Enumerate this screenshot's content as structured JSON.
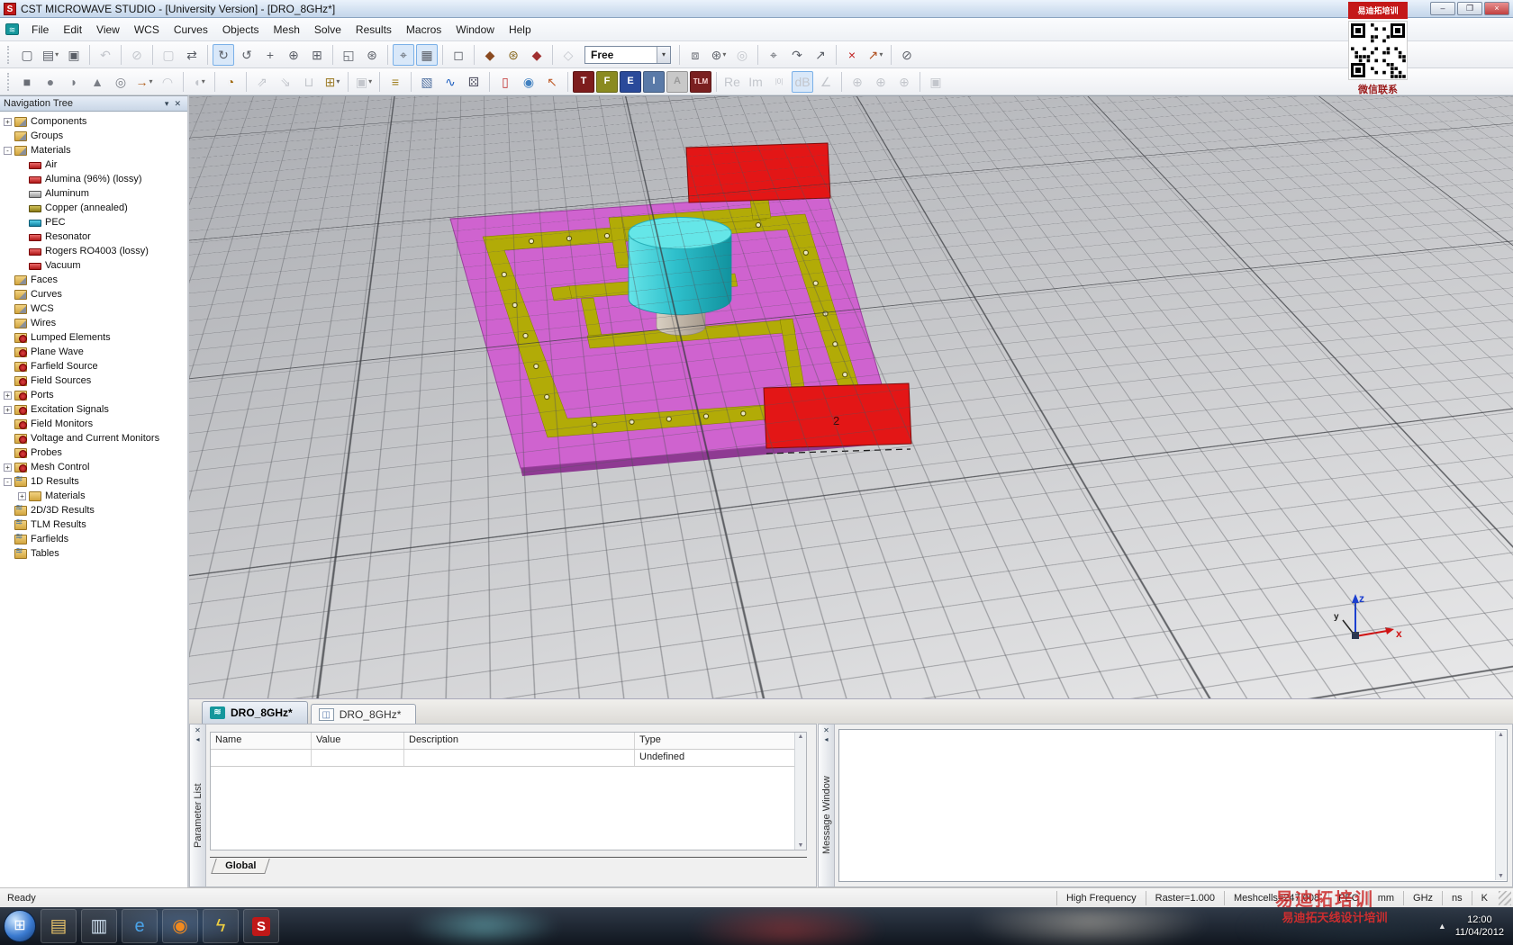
{
  "window": {
    "title": "CST MICROWAVE STUDIO - [University Version] - [DRO_8GHz*]",
    "min_label": "–",
    "restore_label": "❐",
    "close_label": "×"
  },
  "menu": {
    "items": [
      "File",
      "Edit",
      "View",
      "WCS",
      "Curves",
      "Objects",
      "Mesh",
      "Solve",
      "Results",
      "Macros",
      "Window",
      "Help"
    ]
  },
  "toolbars": {
    "row1": [
      {
        "n": "new-file",
        "g": "▢"
      },
      {
        "n": "open-file",
        "g": "▤",
        "d": 1
      },
      {
        "n": "save",
        "g": "▣"
      },
      {
        "sep": true
      },
      {
        "n": "undo",
        "g": "↶",
        "s": "g"
      },
      {
        "sep": true
      },
      {
        "n": "abort",
        "g": "⊘",
        "s": "g"
      },
      {
        "sep": true
      },
      {
        "n": "select-tool",
        "g": "▢",
        "s": "g"
      },
      {
        "n": "exchange-tool",
        "g": "⇄"
      },
      {
        "sep": true
      },
      {
        "n": "rotate-view",
        "g": "↻",
        "s": "a"
      },
      {
        "n": "rotate-in-plane",
        "g": "↺"
      },
      {
        "n": "pan-view",
        "g": "+"
      },
      {
        "n": "zoom-dynamic",
        "g": "⊕"
      },
      {
        "n": "zoom-rectangle",
        "g": "⊞"
      },
      {
        "sep": true
      },
      {
        "n": "reset-view",
        "g": "◱"
      },
      {
        "n": "view-options",
        "g": "⊛"
      },
      {
        "sep": true
      },
      {
        "n": "show-axes",
        "g": "⌖",
        "s": "a"
      },
      {
        "n": "show-working-plane-raster",
        "g": "▦",
        "s": "a"
      },
      {
        "sep": true
      },
      {
        "n": "wireframe-view",
        "g": "◻"
      },
      {
        "sep": true
      },
      {
        "n": "material-tool-brown",
        "g": "◆",
        "fg": "#8a4a20"
      },
      {
        "n": "material-parameters",
        "g": "⊛",
        "fg": "#8a6a20"
      },
      {
        "n": "material-tool-red",
        "g": "◆",
        "fg": "#a03030"
      },
      {
        "sep": true
      },
      {
        "n": "shape-blend",
        "g": "◇",
        "s": "g"
      },
      {
        "combo": true,
        "n": "pick-mode-combo",
        "v": "Free"
      },
      {
        "sep": true
      },
      {
        "n": "working-plane-properties",
        "g": "⧈"
      },
      {
        "n": "global-mesh-properties",
        "g": "⊛",
        "d": 1
      },
      {
        "n": "specials",
        "g": "◎",
        "s": "g"
      },
      {
        "sep": true
      },
      {
        "n": "local-wcs",
        "g": "⌖"
      },
      {
        "n": "align-wcs",
        "g": "↷"
      },
      {
        "n": "transform-wcs",
        "g": "↗"
      },
      {
        "sep": true
      },
      {
        "n": "slice-tool",
        "g": "×",
        "fg": "#c02020"
      },
      {
        "n": "pick-points",
        "g": "↗",
        "fg": "#b05020",
        "d": 1
      },
      {
        "sep": true
      },
      {
        "n": "clear-picks",
        "g": "⊘"
      }
    ],
    "row2": [
      {
        "n": "create-brick",
        "g": "■",
        "fg": "#6a6e76"
      },
      {
        "n": "create-sphere",
        "g": "●",
        "fg": "#7a7e86"
      },
      {
        "n": "create-cylinder",
        "g": "◗",
        "fg": "#7a7e86"
      },
      {
        "n": "create-cone",
        "g": "▲",
        "fg": "#7a7e86"
      },
      {
        "n": "create-torus",
        "g": "◎",
        "fg": "#7a7e86"
      },
      {
        "n": "extrude",
        "g": "→",
        "fg": "#b06020",
        "d": 1
      },
      {
        "n": "loft",
        "g": "◠",
        "s": "g"
      },
      {
        "sep": true
      },
      {
        "n": "blend",
        "g": "◖",
        "s": "g",
        "d": 1
      },
      {
        "sep": true
      },
      {
        "n": "history-list",
        "g": "◔",
        "fg": "#a06a10"
      },
      {
        "sep": true
      },
      {
        "n": "transform-shape",
        "g": "⇗",
        "s": "g"
      },
      {
        "n": "align-shape",
        "g": "⇘",
        "s": "g"
      },
      {
        "n": "boolean-tool",
        "g": "⊔",
        "s": "g"
      },
      {
        "n": "new-component",
        "g": "⊞",
        "fg": "#a08030",
        "d": 1
      },
      {
        "sep": true
      },
      {
        "n": "group-tool",
        "g": "▣",
        "s": "g",
        "d": 1
      },
      {
        "sep": true
      },
      {
        "n": "units",
        "g": "≡",
        "fg": "#a08020"
      },
      {
        "sep": true
      },
      {
        "n": "background-properties",
        "g": "▧",
        "fg": "#5070a0"
      },
      {
        "n": "frequency-range",
        "g": "∿",
        "fg": "#2060c0"
      },
      {
        "n": "boundary-conditions",
        "g": "⚄",
        "fg": "#556"
      },
      {
        "sep": true
      },
      {
        "n": "edit-history",
        "g": "▯",
        "fg": "#c03030"
      },
      {
        "n": "parametric-update",
        "g": "◉",
        "fg": "#4080c0"
      },
      {
        "n": "pick-pointer",
        "g": "↖",
        "fg": "#c06030"
      },
      {
        "sep": true
      },
      {
        "n": "time-solver",
        "g": "T",
        "bg": "#7d1d1d",
        "fg": "#ffffff"
      },
      {
        "n": "frequency-solver",
        "g": "F",
        "bg": "#8a8a20",
        "fg": "#ffffff"
      },
      {
        "n": "eigenmode-solver",
        "g": "E",
        "bg": "#2a4a9a",
        "fg": "#ffffff"
      },
      {
        "n": "integral-solver",
        "g": "I",
        "bg": "#5a7aa8",
        "fg": "#ffffff"
      },
      {
        "n": "asymptotic-solver",
        "g": "A",
        "bg": "#c8c8c8",
        "fg": "#9a9a9a",
        "s": "g"
      },
      {
        "n": "tlm-solver",
        "g": "TLM",
        "bg": "#7a2020",
        "fg": "#ffd8d8"
      },
      {
        "sep": true
      },
      {
        "n": "plot-real",
        "g": "Re",
        "s": "g"
      },
      {
        "n": "plot-imaginary",
        "g": "Im",
        "s": "g"
      },
      {
        "n": "plot-magnitude",
        "g": "|0|",
        "s": "g"
      },
      {
        "n": "plot-db",
        "g": "dB",
        "s": "ga"
      },
      {
        "n": "plot-phase",
        "g": "∠",
        "s": "g"
      },
      {
        "sep": true
      },
      {
        "n": "farfield-plot-1",
        "g": "⊕",
        "s": "g"
      },
      {
        "n": "farfield-plot-2",
        "g": "⊕",
        "s": "g"
      },
      {
        "n": "farfield-plot-3",
        "g": "⊕",
        "s": "g"
      },
      {
        "sep": true
      },
      {
        "n": "export-results",
        "g": "▣",
        "s": "g"
      }
    ],
    "free_value": "Free"
  },
  "nav_tree": {
    "title": "Navigation Tree",
    "items": [
      {
        "t": "Components",
        "l": 1,
        "e": "+",
        "i": "ftri"
      },
      {
        "t": "Groups",
        "l": 1,
        "i": "ftri"
      },
      {
        "t": "Materials",
        "l": 1,
        "e": "-",
        "i": "ftri"
      },
      {
        "t": "Air",
        "l": 2,
        "i": "brick-red"
      },
      {
        "t": "Alumina (96%) (lossy)",
        "l": 2,
        "i": "brick-red"
      },
      {
        "t": "Aluminum",
        "l": 2,
        "i": "brick-gray"
      },
      {
        "t": "Copper (annealed)",
        "l": 2,
        "i": "brick-olive"
      },
      {
        "t": "PEC",
        "l": 2,
        "i": "brick-teal"
      },
      {
        "t": "Resonator",
        "l": 2,
        "i": "brick-red"
      },
      {
        "t": "Rogers RO4003 (lossy)",
        "l": 2,
        "i": "brick-red"
      },
      {
        "t": "Vacuum",
        "l": 2,
        "i": "brick-red"
      },
      {
        "t": "Faces",
        "l": 1,
        "i": "ftri"
      },
      {
        "t": "Curves",
        "l": 1,
        "i": "ftri"
      },
      {
        "t": "WCS",
        "l": 1,
        "i": "ftri"
      },
      {
        "t": "Wires",
        "l": 1,
        "i": "ftri"
      },
      {
        "t": "Lumped Elements",
        "l": 1,
        "i": "fgear"
      },
      {
        "t": "Plane Wave",
        "l": 1,
        "i": "fgear"
      },
      {
        "t": "Farfield Source",
        "l": 1,
        "i": "fgear"
      },
      {
        "t": "Field Sources",
        "l": 1,
        "i": "fgear"
      },
      {
        "t": "Ports",
        "l": 1,
        "e": "+",
        "i": "fgear"
      },
      {
        "t": "Excitation Signals",
        "l": 1,
        "e": "+",
        "i": "fgear"
      },
      {
        "t": "Field Monitors",
        "l": 1,
        "i": "fgear"
      },
      {
        "t": "Voltage and Current Monitors",
        "l": 1,
        "i": "fgear"
      },
      {
        "t": "Probes",
        "l": 1,
        "i": "fgear"
      },
      {
        "t": "Mesh Control",
        "l": 1,
        "e": "+",
        "i": "fgear"
      },
      {
        "t": "1D Results",
        "l": 1,
        "e": "-",
        "i": "fres"
      },
      {
        "t": "Materials",
        "l": 2,
        "e": "+",
        "i": "fplain"
      },
      {
        "t": "2D/3D Results",
        "l": 1,
        "i": "fres"
      },
      {
        "t": "TLM Results",
        "l": 1,
        "i": "fres"
      },
      {
        "t": "Farfields",
        "l": 1,
        "i": "fres"
      },
      {
        "t": "Tables",
        "l": 1,
        "i": "fres"
      }
    ]
  },
  "tabs": [
    {
      "label": "DRO_8GHz*",
      "active": true
    },
    {
      "label": "DRO_8GHz*",
      "active": false
    }
  ],
  "parameter_list": {
    "vertical_label": "Parameter List",
    "columns": [
      "Name",
      "Value",
      "Description",
      "Type"
    ],
    "rows": [
      {
        "name": "",
        "value": "",
        "description": "",
        "type": "Undefined"
      }
    ],
    "bottom_tab": "Global"
  },
  "message_window": {
    "vertical_label": "Message Window"
  },
  "status_bar": {
    "ready": "Ready",
    "segments": [
      "High Frequency",
      "Raster=1.000",
      "Meshcells=247,008",
      "PEC",
      "mm",
      "GHz",
      "ns",
      "K"
    ]
  },
  "taskbar": {
    "icons": [
      {
        "n": "libraries-folder",
        "g": "▤",
        "fg": "#e8c36a"
      },
      {
        "n": "file-explorer",
        "g": "▥",
        "fg": "#cfe0f0"
      },
      {
        "n": "internet-explorer",
        "g": "e",
        "fg": "#4aa3e8"
      },
      {
        "n": "firefox",
        "g": "◉",
        "fg": "#f28a1f"
      },
      {
        "n": "media-app",
        "g": "ϟ",
        "fg": "#f0d040"
      },
      {
        "n": "cst-studio",
        "g": "S",
        "fg": "#ffffff",
        "bg": "#c01818"
      }
    ],
    "clock_time": "12:00",
    "clock_date": "11/04/2012",
    "tray_arrow": "▲",
    "start_glyph": "⊞"
  },
  "viewport": {
    "port2_label": "2",
    "axes": {
      "x": "x",
      "y": "y",
      "z": "z"
    }
  },
  "watermarks": {
    "qr_banner": "易迪拓培训",
    "qr_caption": "微信联系",
    "status_text": "易迪拓培训",
    "tray_text": "易迪拓天线设计培训"
  },
  "colors": {
    "substrate": "#cf63cf",
    "trace": "#b2ab07",
    "resonator": "#2fc0cc",
    "port": "#e31616",
    "accent_active": "#7ab0e8"
  }
}
